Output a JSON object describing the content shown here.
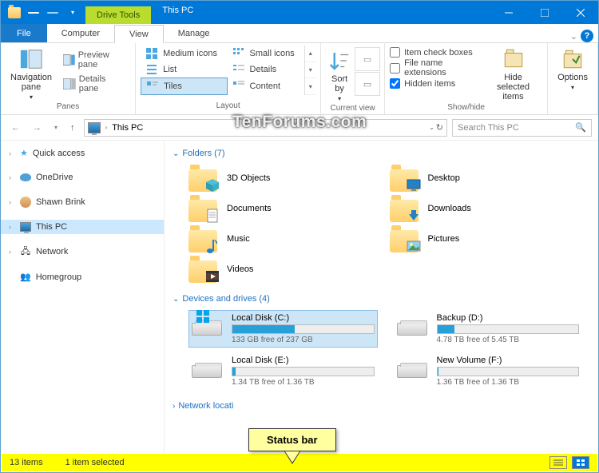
{
  "title": "This PC",
  "drive_tools_label": "Drive Tools",
  "tabs": {
    "file": "File",
    "computer": "Computer",
    "view": "View",
    "manage": "Manage"
  },
  "ribbon": {
    "panes": {
      "nav": "Navigation\npane",
      "preview": "Preview pane",
      "details": "Details pane",
      "group": "Panes"
    },
    "layout": {
      "medium": "Medium icons",
      "small": "Small icons",
      "list": "List",
      "details": "Details",
      "tiles": "Tiles",
      "content": "Content",
      "group": "Layout"
    },
    "currentview": {
      "sortby": "Sort\nby",
      "group": "Current view"
    },
    "showhide": {
      "itemcheck": "Item check boxes",
      "ext": "File name extensions",
      "hidden": "Hidden items",
      "hidesel": "Hide selected\nitems",
      "group": "Show/hide"
    },
    "options": {
      "label": "Options"
    }
  },
  "address": {
    "path": "This PC",
    "search_ph": "Search This PC"
  },
  "nav": {
    "quick": "Quick access",
    "onedrive": "OneDrive",
    "user": "Shawn Brink",
    "thispc": "This PC",
    "network": "Network",
    "homegroup": "Homegroup"
  },
  "sections": {
    "folders": {
      "header": "Folders (7)",
      "items": [
        "3D Objects",
        "Desktop",
        "Documents",
        "Downloads",
        "Music",
        "Pictures",
        "Videos"
      ]
    },
    "drives": {
      "header": "Devices and drives (4)",
      "items": [
        {
          "name": "Local Disk (C:)",
          "free": "133 GB free of 237 GB",
          "pct": 44,
          "win": true
        },
        {
          "name": "Backup (D:)",
          "free": "4.78 TB free of 5.45 TB",
          "pct": 12
        },
        {
          "name": "Local Disk (E:)",
          "free": "1.34 TB free of 1.36 TB",
          "pct": 2
        },
        {
          "name": "New Volume (F:)",
          "free": "1.36 TB free of 1.36 TB",
          "pct": 1
        }
      ]
    },
    "network": {
      "header": "Network locati"
    }
  },
  "status": {
    "count": "13 items",
    "sel": "1 item selected"
  },
  "callout": "Status bar",
  "watermark": "TenForums.com"
}
